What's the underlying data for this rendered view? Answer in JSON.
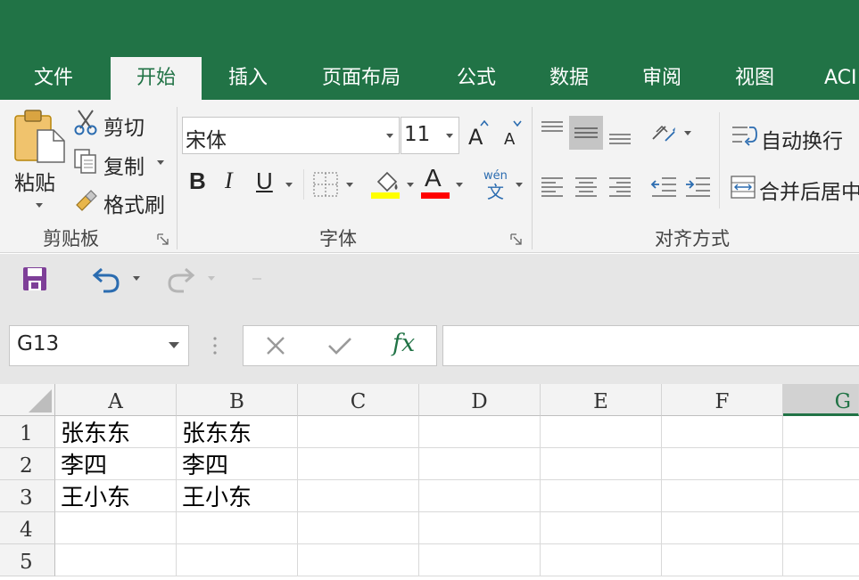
{
  "ribbon_tabs": [
    "文件",
    "开始",
    "插入",
    "页面布局",
    "公式",
    "数据",
    "审阅",
    "视图",
    "ACI"
  ],
  "clipboard": {
    "paste_label": "粘贴",
    "cut_label": "剪切",
    "copy_label": "复制",
    "format_painter_label": "格式刷",
    "group_label": "剪贴板"
  },
  "font": {
    "name": "宋体",
    "size": "11",
    "grow_label": "A",
    "shrink_label": "A",
    "bold_label": "B",
    "italic_label": "I",
    "underline_label": "U",
    "font_color_label": "A",
    "phonetic_top": "wén",
    "phonetic_bottom": "文",
    "group_label": "字体",
    "fill_color": "#ffff00",
    "text_color": "#ff0000"
  },
  "alignment": {
    "wrap_text_label": "自动换行",
    "merge_center_label": "合并后居中",
    "group_label": "对齐方式"
  },
  "formula_bar": {
    "name_box": "G13",
    "fx_label": "fx",
    "formula": ""
  },
  "sheet": {
    "columns": [
      "A",
      "B",
      "C",
      "D",
      "E",
      "F",
      "G"
    ],
    "selected_column": "G",
    "rows": [
      {
        "row": "1",
        "cells": [
          "张东东",
          "张东东",
          "",
          "",
          "",
          "",
          ""
        ]
      },
      {
        "row": "2",
        "cells": [
          "李四",
          "李四",
          "",
          "",
          "",
          "",
          ""
        ]
      },
      {
        "row": "3",
        "cells": [
          "王小东",
          "王小东",
          "",
          "",
          "",
          "",
          ""
        ]
      },
      {
        "row": "4",
        "cells": [
          "",
          "",
          "",
          "",
          "",
          "",
          ""
        ]
      },
      {
        "row": "5",
        "cells": [
          "",
          "",
          "",
          "",
          "",
          "",
          ""
        ]
      }
    ]
  },
  "colors": {
    "brand": "#217346",
    "ribbon_bg": "#f3f3f3",
    "toolbar_bg": "#e6e6e6",
    "save_icon": "#7e3f98",
    "undo_icon": "#2b6cb0"
  }
}
